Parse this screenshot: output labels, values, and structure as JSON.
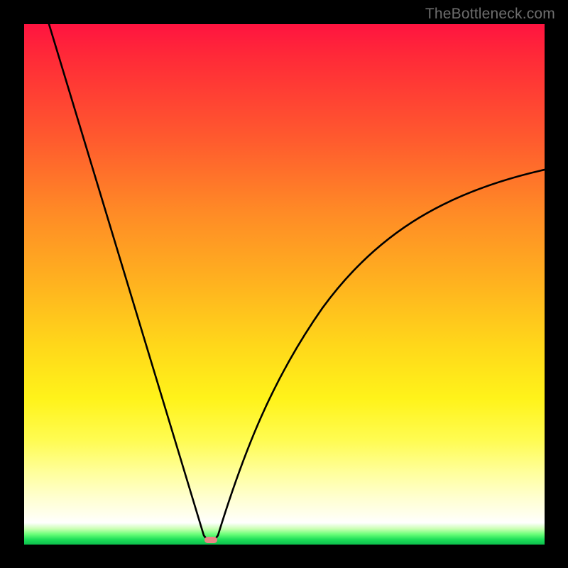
{
  "watermark": "TheBottleneck.com",
  "colors": {
    "background_frame": "#000000",
    "gradient_top": "#ff1440",
    "gradient_mid": "#ffd81a",
    "gradient_bottom": "#0cbf4c",
    "curve_stroke": "#000000",
    "marker_fill": "#e98686"
  },
  "chart_data": {
    "type": "line",
    "title": "",
    "xlabel": "",
    "ylabel": "",
    "xlim": [
      0,
      100
    ],
    "ylim": [
      0,
      100
    ],
    "axes_visible": false,
    "grid": false,
    "background": "red-yellow-green vertical gradient",
    "notes": "V-shaped curve: steep near-linear descent on left, sharp minimum near x≈36 reaching y≈0, then concave-increasing rise on the right approaching ~y≈72 at x=100. Small salmon rounded marker at the curve minimum on the baseline.",
    "series": [
      {
        "name": "curve",
        "x": [
          0,
          4,
          8,
          12,
          16,
          20,
          24,
          28,
          30,
          32,
          34,
          35,
          36,
          37,
          38,
          40,
          42,
          44,
          48,
          52,
          56,
          60,
          64,
          68,
          72,
          76,
          80,
          84,
          88,
          92,
          96,
          100
        ],
        "y": [
          100,
          89,
          78,
          67,
          56,
          45,
          34,
          22,
          16,
          10,
          4,
          1.5,
          0,
          1.5,
          5,
          11,
          17,
          22,
          30,
          37,
          42,
          47,
          51,
          55,
          58,
          61,
          64,
          66,
          68,
          70,
          71,
          72
        ]
      }
    ],
    "marker": {
      "x": 36,
      "y": 0,
      "shape": "rounded-rect",
      "color": "#e98686"
    }
  }
}
